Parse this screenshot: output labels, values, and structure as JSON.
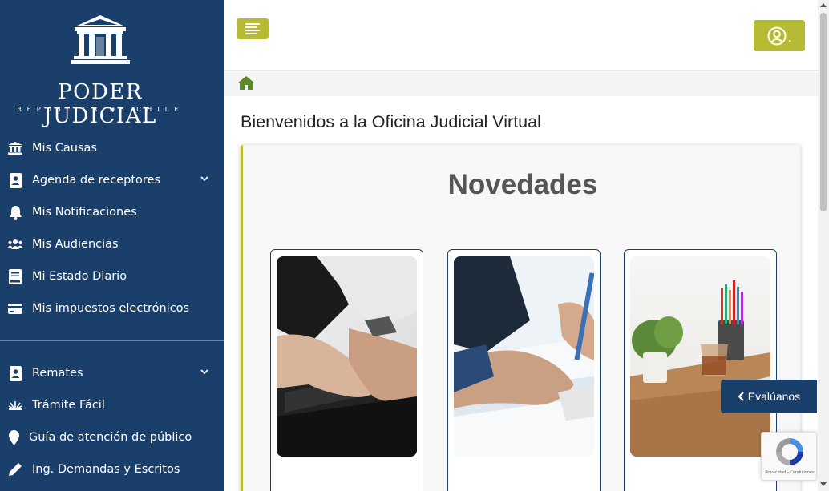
{
  "brand": {
    "title": "PODER JUDICIAL",
    "subtitle": "REPUBLICA DE CHILE"
  },
  "sidebar": {
    "items": [
      {
        "label": "Mis Causas",
        "icon": "bank-icon"
      },
      {
        "label": "Agenda de receptores",
        "icon": "id-badge-icon",
        "has_submenu": true
      },
      {
        "label": "Mis Notificaciones",
        "icon": "bell-icon"
      },
      {
        "label": "Mis Audiencias",
        "icon": "users-icon"
      },
      {
        "label": "Mi Estado Diario",
        "icon": "book-icon"
      },
      {
        "label": "Mis impuestos electrónicos",
        "icon": "credit-card-icon"
      },
      {
        "label": "Remates",
        "icon": "id-badge-icon",
        "has_submenu": true
      },
      {
        "label": "Trámite Fácil",
        "icon": "spark-icon"
      },
      {
        "label": "Guía de atención de público",
        "icon": "map-marker-icon"
      },
      {
        "label": "Ing. Demandas y Escritos",
        "icon": "pencil-icon"
      }
    ]
  },
  "header": {
    "menu_icon": "hamburger-icon",
    "user_icon": "user-circle-icon",
    "user_label": "."
  },
  "breadcrumb": {
    "home_icon": "home-icon"
  },
  "main": {
    "page_title": "Bienvenidos a la Oficina Judicial Virtual",
    "section_title": "Novedades",
    "news_cards": [
      {
        "image": "typing-hands-on-keyboard"
      },
      {
        "image": "hands-signing-documents"
      },
      {
        "image": "desk-with-plants-and-pencils"
      }
    ]
  },
  "feedback": {
    "label": "Evalúanos",
    "icon": "chevron-left-icon"
  },
  "recaptcha": {
    "text": "Privacidad - Condiciones"
  },
  "colors": {
    "sidebar_bg": "#1b3f6b",
    "accent": "#b7bb33",
    "home_icon": "#5a8a28"
  }
}
